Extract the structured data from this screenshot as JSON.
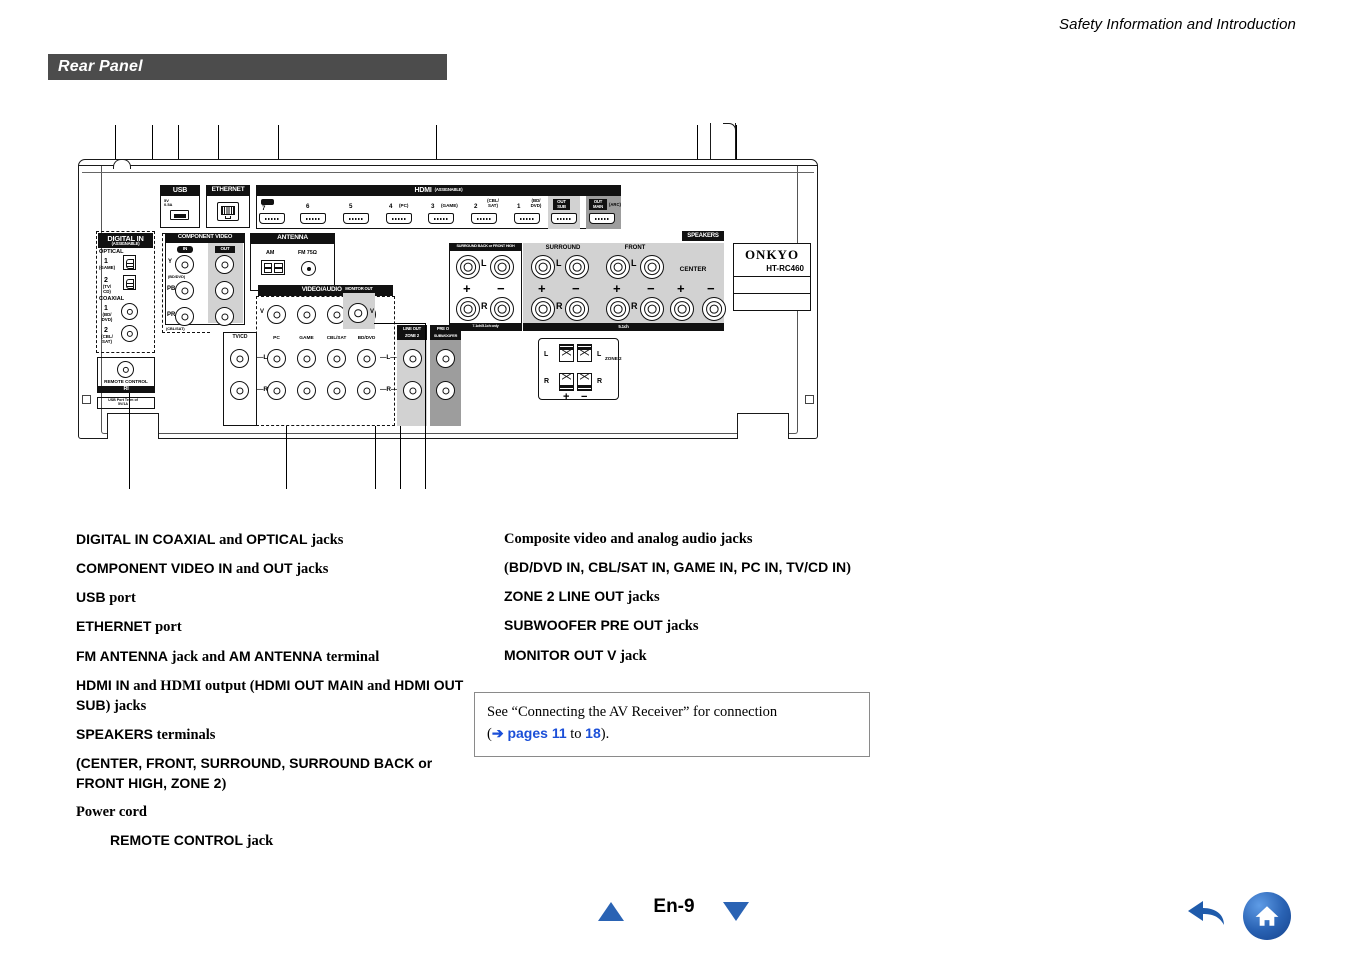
{
  "header": {
    "running_head": "Safety Information and Introduction"
  },
  "section": {
    "title": "Rear Panel"
  },
  "diagram": {
    "brand": "ONKYO",
    "model": "HT-RC460",
    "labels": {
      "usb": "USB",
      "usb_spec": "5V\n0.5A",
      "ethernet": "ETHERNET",
      "hdmi": "HDMI",
      "hdmi_assignable": "(ASSIGNABLE)",
      "digital_in": "DIGITAL IN",
      "digital_in_assignable": "(ASSIGNABLE)",
      "optical": "OPTICAL",
      "optical_1": "1",
      "optical_1_sub": "(GAME)",
      "optical_2": "2",
      "optical_2_sub": "(TV/\nCD)",
      "coaxial": "COAXIAL",
      "coax_1": "1",
      "coax_1_sub": "(BD/\nDVD)",
      "coax_2": "2",
      "coax_2_sub": "(CBL/\nSAT)",
      "remote_control": "REMOTE CONTROL",
      "ri": "RI",
      "ri_note": "USB Port Term of\n5V/1A",
      "component_video": "COMPONENT VIDEO",
      "cv_in": "IN",
      "cv_out": "OUT",
      "cv_y": "Y",
      "cv_pb": "PB",
      "cv_pr": "PR",
      "cv_y_sub": "(BD/DVD)",
      "cv_pr_sub": "(CBL/SAT)",
      "antenna": "ANTENNA",
      "am": "AM",
      "fm": "FM 75Ω",
      "video_audio_in": "VIDEO/AUDIO IN",
      "monitor_out": "MONITOR OUT",
      "v": "V",
      "l": "L",
      "r": "R",
      "tvcd": "TV/CD",
      "pc": "PC",
      "game": "GAME",
      "cblsat": "CBL/SAT",
      "bddvd": "BD/DVD",
      "line_out": "LINE OUT",
      "zone2": "ZONE 2",
      "pre_out": "PRE OUT",
      "subwoofer": "SUBWOOFER",
      "speakers": "SPEAKERS",
      "surround_back_front_high": "SURROUND BACK or FRONT HIGH",
      "surround": "SURROUND",
      "front": "FRONT",
      "center": "CENTER",
      "seven_one_note": "7.1ch/5.1ch only",
      "five_one": "5.1ch",
      "zone2_sp": "ZONE 2",
      "plus": "+",
      "minus": "−",
      "out_sub": "OUT\nSUB",
      "out_main": "OUT\nMAIN",
      "arc": "(ARC)",
      "ir": "IR"
    },
    "hdmi_ports": [
      {
        "num": "7",
        "sub": ""
      },
      {
        "num": "6",
        "sub": ""
      },
      {
        "num": "5",
        "sub": ""
      },
      {
        "num": "4",
        "sub": "(PC)"
      },
      {
        "num": "3",
        "sub": "(GAME)"
      },
      {
        "num": "2",
        "sub": "(CBL/\nSAT)"
      },
      {
        "num": "1",
        "sub": "(BD/\nDVD)"
      }
    ]
  },
  "callouts": {
    "left": [
      {
        "bold": "DIGITAL IN COAXIAL",
        "mid": " and ",
        "bold2": "OPTICAL",
        "tail": " jacks"
      },
      {
        "bold": "COMPONENT VIDEO IN",
        "mid": " and ",
        "bold2": "OUT",
        "tail": " jacks"
      },
      {
        "bold": "USB",
        "mid": "",
        "bold2": "",
        "tail": " port"
      },
      {
        "bold": "ETHERNET",
        "mid": "",
        "bold2": "",
        "tail": " port"
      },
      {
        "bold": "FM ANTENNA",
        "mid": " jack and ",
        "bold2": "AM ANTENNA",
        "tail": " terminal"
      },
      {
        "bold": "HDMI IN",
        "mid": " and HDMI output (",
        "bold2": "HDMI OUT MAIN",
        "tail": " and"
      },
      {
        "bold": "HDMI OUT SUB",
        "mid": "",
        "bold2": "",
        "tail": ") jacks"
      },
      {
        "bold": "SPEAKERS",
        "mid": "",
        "bold2": "",
        "tail": " terminals"
      },
      {
        "bold": "(CENTER, FRONT, SURROUND, SURROUND",
        "mid": "",
        "bold2": "",
        "tail": ""
      },
      {
        "bold": "BACK or FRONT HIGH, ZONE 2",
        "mid": "",
        "bold2": "",
        "tail": ")"
      },
      {
        "bold": "",
        "mid": "",
        "bold2": "",
        "tail": "Power cord"
      },
      {
        "bold": "REMOTE CONTROL",
        "mid": "",
        "bold2": "",
        "tail": " jack"
      }
    ],
    "left_lines": [
      "DIGITAL IN COAXIAL and OPTICAL jacks",
      "COMPONENT VIDEO IN and OUT jacks",
      "USB port",
      "ETHERNET port",
      "FM ANTENNA jack and AM ANTENNA terminal",
      "HDMI IN and HDMI output (HDMI OUT MAIN and HDMI OUT SUB) jacks",
      "SPEAKERS terminals (CENTER, FRONT, SURROUND, SURROUND BACK or FRONT HIGH, ZONE 2)",
      "Power cord",
      "REMOTE CONTROL jack"
    ],
    "right_lines": [
      "Composite video and analog audio jacks (BD/DVD IN, CBL/SAT IN, GAME IN, PC IN, TV/CD IN)",
      "ZONE 2 LINE OUT jacks",
      "SUBWOOFER PRE OUT jacks",
      "MONITOR OUT V jack"
    ]
  },
  "text": {
    "l1_a": "DIGITAL IN COAXIAL",
    "l1_b": " and ",
    "l1_c": "OPTICAL",
    "l1_d": " jacks",
    "l2_a": "COMPONENT VIDEO IN",
    "l2_b": " and ",
    "l2_c": "OUT",
    "l2_d": " jacks",
    "l3_a": "USB",
    "l3_d": " port",
    "l4_a": "ETHERNET",
    "l4_d": " port",
    "l5_a": "FM ANTENNA",
    "l5_b": " jack and ",
    "l5_c": "AM ANTENNA",
    "l5_d": " terminal",
    "l6_a": "HDMI IN",
    "l6_b": " and HDMI output (",
    "l6_c": "HDMI OUT MAIN",
    "l6_d": " and ",
    "l6_e": "HDMI OUT SUB",
    "l6_f": ") jacks",
    "l7_a": "SPEAKERS",
    "l7_d": " terminals",
    "l8_a": "(CENTER, FRONT, SURROUND, SURROUND BACK or FRONT HIGH, ZONE 2",
    "l8_d": ")",
    "l9_d": "Power cord",
    "l10_a": "REMOTE CONTROL",
    "l10_d": " jack",
    "r1_a": "Composite video and analog audio jacks",
    "r2_open": "(",
    "r2_a": "BD/DVD IN, CBL/SAT IN, GAME IN, PC IN, TV/CD IN",
    "r2_close": ")",
    "r3_a": "ZONE 2 LINE OUT",
    "r3_d": " jacks",
    "r4_a": "SUBWOOFER PRE OUT",
    "r4_d": " jacks",
    "r5_a": "MONITOR OUT V",
    "r5_d": " jack"
  },
  "note": {
    "line1": "See “Connecting the AV Receiver” for connection",
    "open_paren": "(",
    "arrow_pages": "➔ pages 11",
    "to": " to ",
    "page_end": "18",
    "close": ").",
    "link_color": "#1b4fd8"
  },
  "footer": {
    "page": "En-9",
    "prev_icon": "triangle-up-icon",
    "next_icon": "triangle-down-icon",
    "back_icon": "back-arrow-icon",
    "home_icon": "home-icon",
    "accent_color": "#2a63b4"
  }
}
